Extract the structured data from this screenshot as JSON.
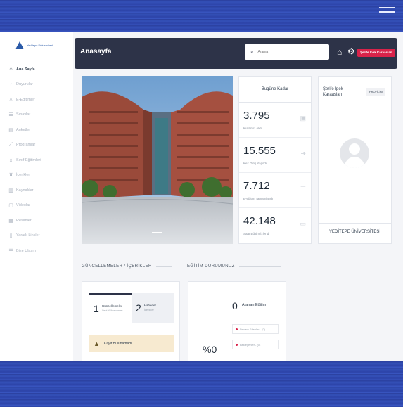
{
  "app": {
    "logo_text": "Yeditepe Üniversitesi"
  },
  "sidebar": {
    "items": [
      {
        "label": "Ana Sayfa",
        "icon": "home-icon",
        "glyph": "⌂",
        "active": true
      },
      {
        "label": "Duyurular",
        "icon": "bullhorn-icon",
        "glyph": "◔",
        "active": false
      },
      {
        "label": "E-Eğitimler",
        "icon": "graduation-cap-icon",
        "glyph": "♙",
        "active": false
      },
      {
        "label": "Sınavlar",
        "icon": "exam-icon",
        "glyph": "☰",
        "active": false
      },
      {
        "label": "Anketler",
        "icon": "survey-icon",
        "glyph": "▤",
        "active": false
      },
      {
        "label": "Programlar",
        "icon": "chart-line-icon",
        "glyph": "⟋",
        "active": false
      },
      {
        "label": "Sınıf Eğitimleri",
        "icon": "classroom-icon",
        "glyph": "♗",
        "active": false
      },
      {
        "label": "İçerikler",
        "icon": "content-icon",
        "glyph": "♜",
        "active": false
      },
      {
        "label": "Kaynaklar",
        "icon": "library-icon",
        "glyph": "▥",
        "active": false
      },
      {
        "label": "Videolar",
        "icon": "video-icon",
        "glyph": "▢",
        "active": false
      },
      {
        "label": "Resimler",
        "icon": "image-icon",
        "glyph": "▦",
        "active": false
      },
      {
        "label": "Yararlı Linkler",
        "icon": "link-icon",
        "glyph": "▯",
        "active": false
      },
      {
        "label": "Bize Ulaşın",
        "icon": "contact-icon",
        "glyph": "☷",
        "active": false
      }
    ]
  },
  "header": {
    "title": "Anasayfa",
    "search_placeholder": "Arama",
    "user_label": "Şerife İpek Karaaslan"
  },
  "stats": {
    "heading": "Bugüne Kadar",
    "items": [
      {
        "value": "3.795",
        "label": "Kullanıcı Aktif",
        "icon": "id-card-icon",
        "glyph": "▣"
      },
      {
        "value": "15.555",
        "label": "Kez Giriş Yapıldı",
        "icon": "sign-in-icon",
        "glyph": "➔"
      },
      {
        "value": "7.712",
        "label": "E-eğitim Tamamlandı",
        "icon": "list-icon",
        "glyph": "☰"
      },
      {
        "value": "42.148",
        "label": "Saat Eğitim İzlendi",
        "icon": "monitor-icon",
        "glyph": "▭"
      }
    ]
  },
  "profile": {
    "name": "Şerife İpek Karaaslan",
    "button_label": "PROFİLİM",
    "university": "YEDİTEPE ÜNİVERSİTESİ"
  },
  "updates": {
    "section_title": "GÜNCELLEMELER / İÇERİKLER",
    "tabs": [
      {
        "number": "1",
        "title": "Güncellemeler",
        "subtitle": "Yeni Yüklenenler"
      },
      {
        "number": "2",
        "title": "Haberler",
        "subtitle": "İçerikler"
      }
    ],
    "notice": "Kayıt Bulunamadı"
  },
  "education": {
    "section_title": "EĞİTİM DURUMUNUZ",
    "assigned_count": "0",
    "assigned_label": "Atanan Eğitim",
    "legend": [
      "Devam Edenler - (0)",
      "Bekleyenler - (0)"
    ],
    "percent": "%0"
  },
  "colors": {
    "topbar": "#2d3348",
    "accent": "#d9234a",
    "band": "#2f4cb4"
  }
}
